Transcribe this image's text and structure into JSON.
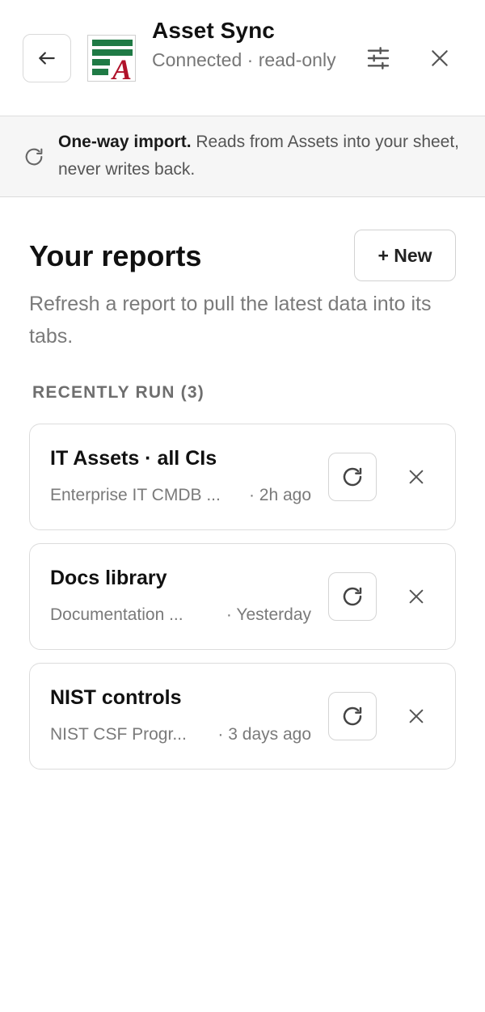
{
  "header": {
    "title": "Asset Sync",
    "status": "Connected · read-only",
    "logo_letter": "A",
    "icons": {
      "back": "arrow-left-icon",
      "settings": "sliders-icon",
      "close": "close-icon"
    }
  },
  "banner": {
    "icon": "refresh-icon",
    "bold": "One-way import.",
    "text": " Reads from Assets into your sheet, never writes back."
  },
  "reports": {
    "title": "Your reports",
    "new_label": "+ New",
    "subtitle": "Refresh a report to pull the latest data into its tabs.",
    "recent_label": "RECENTLY RUN (3)",
    "items": [
      {
        "title": "IT Assets · all CIs",
        "source": "Enterprise IT CMDB ...",
        "time": "· 2h ago"
      },
      {
        "title": "Docs library",
        "source": "Documentation ...",
        "time": "· Yesterday"
      },
      {
        "title": "NIST controls",
        "source": "NIST CSF Progr...",
        "time": "· 3 days ago"
      }
    ]
  },
  "colors": {
    "logo_green": "#1f7a45",
    "logo_red": "#b0122a",
    "muted_text": "#7a7a7a",
    "border": "#dcdcdc"
  }
}
